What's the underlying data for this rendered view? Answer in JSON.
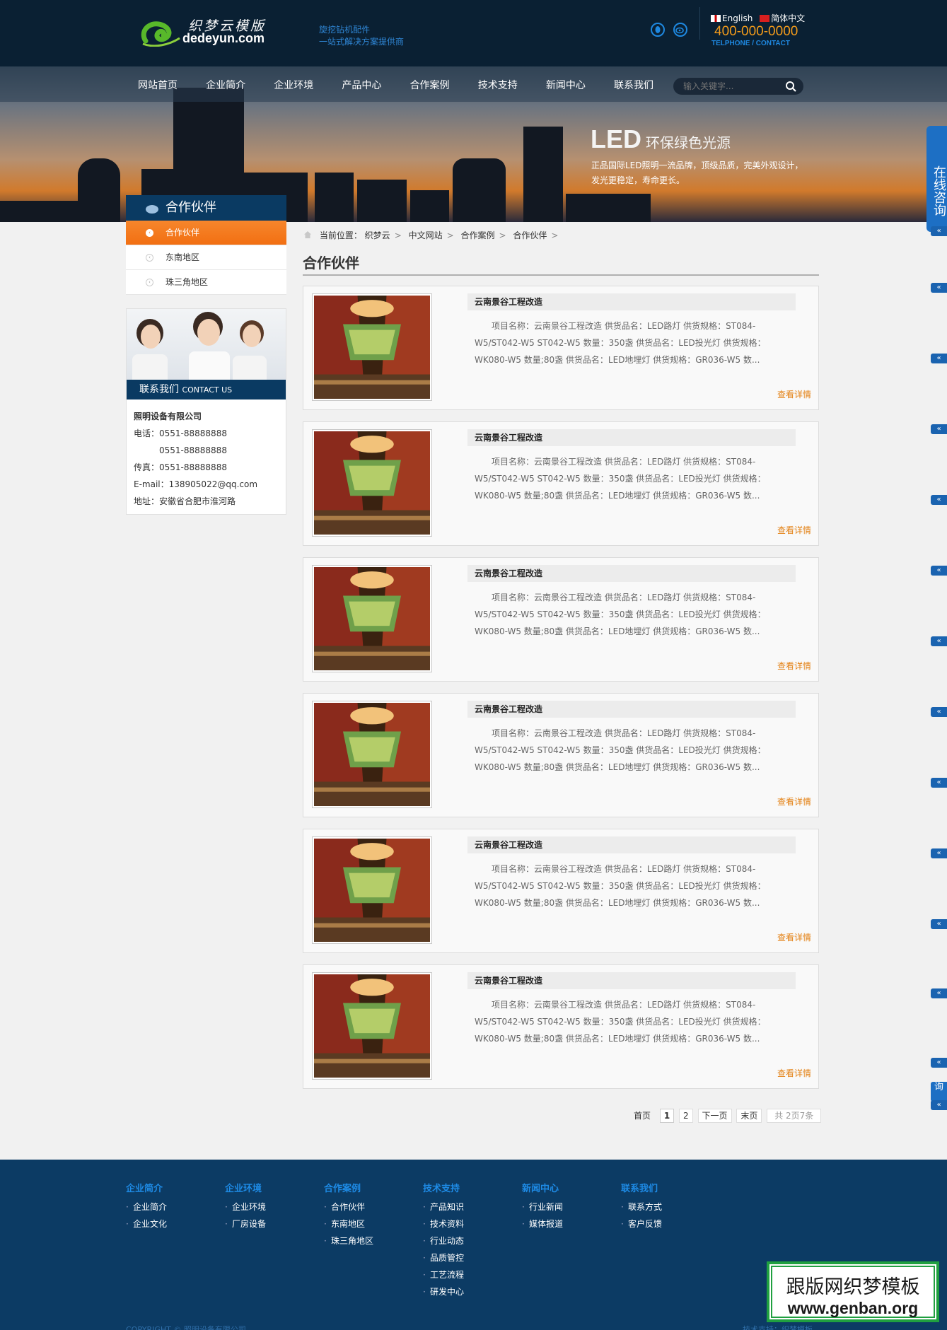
{
  "header": {
    "logo_cn": "织梦云模版",
    "logo_en": "dedeyun.com",
    "slogan_line1": "旋挖钻机配件",
    "slogan_line2": "一站式解决方案提供商",
    "lang_en": "English",
    "lang_cn": "简体中文",
    "phone": "400-000-0000",
    "phone_sub": "TELPHONE / CONTACT"
  },
  "nav": {
    "items": [
      "网站首页",
      "企业简介",
      "企业环境",
      "产品中心",
      "合作案例",
      "技术支持",
      "新闻中心",
      "联系我们"
    ],
    "search_placeholder": "输入关键字..."
  },
  "banner": {
    "led": "LED",
    "led_sub": "环保绿色光源",
    "desc_line1": "正品国际LED照明一流品牌，顶级品质，完美外观设计，",
    "desc_line2": "发光更稳定，寿命更长。"
  },
  "side_consult": "在线咨询",
  "side_consult_bottom": "询",
  "side_tab_label": "«",
  "sidebar": {
    "title": "合作伙伴",
    "items": [
      "合作伙伴",
      "东南地区",
      "珠三角地区"
    ]
  },
  "contact": {
    "title": "联系我们",
    "title_en": "CONTACT US",
    "company": "照明设备有限公司",
    "phone_label": "电话：",
    "phone1": "0551-88888888",
    "phone2": "0551-88888888",
    "fax_label": "传真：",
    "fax": "0551-88888888",
    "email_label": "E-mail：",
    "email": "138905022@qq.com",
    "address_label": "地址：",
    "address": "安徽省合肥市淮河路"
  },
  "breadcrumb": {
    "prefix": "当前位置：",
    "items": [
      "织梦云",
      "中文网站",
      "合作案例",
      "合作伙伴"
    ]
  },
  "page_title": "合作伙伴",
  "cards": [
    {
      "title": "云南景谷工程改造",
      "desc": "项目名称：云南景谷工程改造 供货品名：LED路灯 供货规格：ST084-W5/ST042-W5 ST042-W5 数量：350盏 供货品名：LED投光灯 供货规格：WK080-W5 数量;80盏 供货品名：LED地埋灯 供货规格：GR036-W5 数...",
      "more": "查看详情"
    },
    {
      "title": "云南景谷工程改造",
      "desc": "项目名称：云南景谷工程改造 供货品名：LED路灯 供货规格：ST084-W5/ST042-W5 ST042-W5 数量：350盏 供货品名：LED投光灯 供货规格：WK080-W5 数量;80盏 供货品名：LED地埋灯 供货规格：GR036-W5 数...",
      "more": "查看详情"
    },
    {
      "title": "云南景谷工程改造",
      "desc": "项目名称：云南景谷工程改造 供货品名：LED路灯 供货规格：ST084-W5/ST042-W5 ST042-W5 数量：350盏 供货品名：LED投光灯 供货规格：WK080-W5 数量;80盏 供货品名：LED地埋灯 供货规格：GR036-W5 数...",
      "more": "查看详情"
    },
    {
      "title": "云南景谷工程改造",
      "desc": "项目名称：云南景谷工程改造 供货品名：LED路灯 供货规格：ST084-W5/ST042-W5 ST042-W5 数量：350盏 供货品名：LED投光灯 供货规格：WK080-W5 数量;80盏 供货品名：LED地埋灯 供货规格：GR036-W5 数...",
      "more": "查看详情"
    },
    {
      "title": "云南景谷工程改造",
      "desc": "项目名称：云南景谷工程改造 供货品名：LED路灯 供货规格：ST084-W5/ST042-W5 ST042-W5 数量：350盏 供货品名：LED投光灯 供货规格：WK080-W5 数量;80盏 供货品名：LED地埋灯 供货规格：GR036-W5 数...",
      "more": "查看详情"
    },
    {
      "title": "云南景谷工程改造",
      "desc": "项目名称：云南景谷工程改造 供货品名：LED路灯 供货规格：ST084-W5/ST042-W5 ST042-W5 数量：350盏 供货品名：LED投光灯 供货规格：WK080-W5 数量;80盏 供货品名：LED地埋灯 供货规格：GR036-W5 数...",
      "more": "查看详情"
    }
  ],
  "pagination": {
    "first": "首页",
    "pages": [
      "1",
      "2"
    ],
    "current": "1",
    "next": "下一页",
    "last": "末页",
    "total": "共 2页7条"
  },
  "footer": {
    "columns": [
      {
        "title": "企业简介",
        "links": [
          "企业简介",
          "企业文化"
        ]
      },
      {
        "title": "企业环境",
        "links": [
          "企业环境",
          "厂房设备"
        ]
      },
      {
        "title": "合作案例",
        "links": [
          "合作伙伴",
          "东南地区",
          "珠三角地区"
        ]
      },
      {
        "title": "技术支持",
        "links": [
          "产品知识",
          "技术资料",
          "行业动态",
          "品质管控",
          "工艺流程",
          "研发中心"
        ]
      },
      {
        "title": "新闻中心",
        "links": [
          "行业新闻",
          "媒体报道"
        ]
      },
      {
        "title": "联系我们",
        "links": [
          "联系方式",
          "客户反馈"
        ]
      }
    ],
    "copyright": "COPYRIGHT © 照明设备有限公司",
    "tech": "技术支持：织梦模板"
  },
  "watermark": {
    "line1": "跟版网织梦模板",
    "line2": "www.genban.org"
  },
  "colors": {
    "header_bg": "#0a2033",
    "accent_orange": "#f26f12",
    "nav_dark": "#0a3a62",
    "link_orange": "#e37f10",
    "footer_bg": "#0c3b64",
    "footer_title": "#1e8be6"
  }
}
